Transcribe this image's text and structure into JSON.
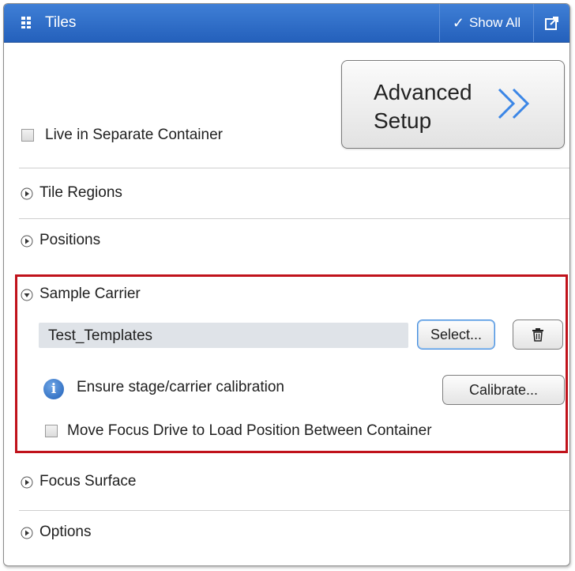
{
  "titlebar": {
    "title": "Tiles",
    "show_all_label": "Show All",
    "accent": "#2f6fcb"
  },
  "advanced_setup": {
    "label": "Advanced Setup",
    "chevron_color": "#3b86e6"
  },
  "live_in_separate_container": {
    "label": "Live in Separate Container",
    "checked": false
  },
  "sections": {
    "tile_regions": {
      "label": "Tile Regions",
      "expanded": false
    },
    "positions": {
      "label": "Positions",
      "expanded": false
    },
    "sample_carrier": {
      "label": "Sample Carrier",
      "expanded": true,
      "template_value": "Test_Templates",
      "select_label": "Select...",
      "delete_icon": "trash-icon",
      "info_text": "Ensure stage/carrier calibration",
      "calibrate_label": "Calibrate...",
      "move_focus_label": "Move Focus Drive to Load Position Between Container",
      "move_focus_checked": false
    },
    "focus_surface": {
      "label": "Focus Surface",
      "expanded": false
    },
    "options": {
      "label": "Options",
      "expanded": false
    }
  },
  "highlight_color": "#c0121b"
}
